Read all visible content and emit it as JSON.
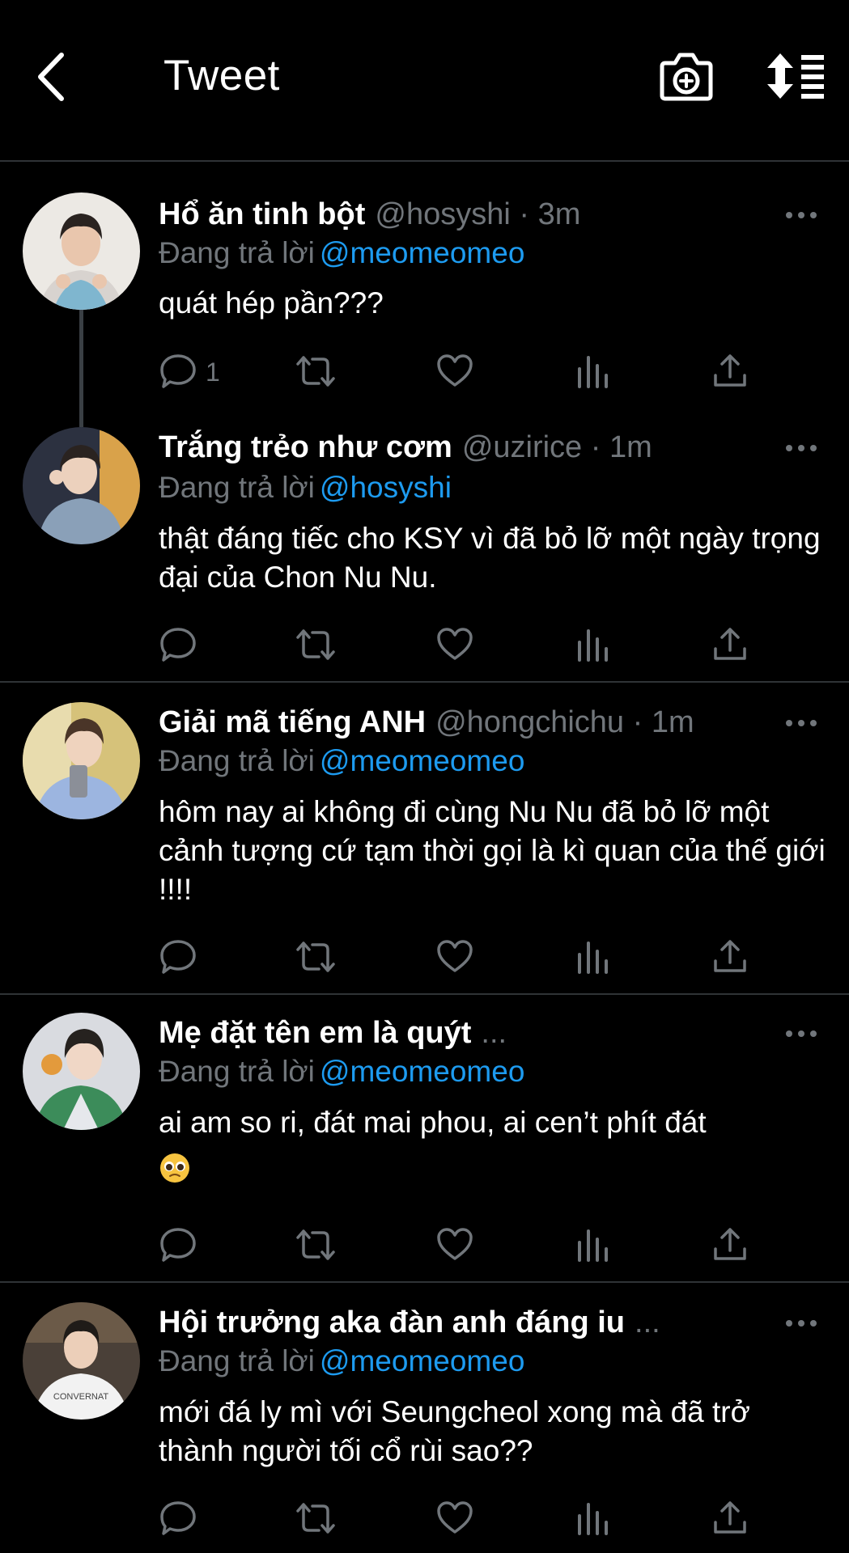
{
  "header": {
    "title": "Tweet",
    "back_icon": "chevron-left-icon",
    "camera_icon": "camera-add-icon",
    "sort_icon": "sort-list-icon"
  },
  "colors": {
    "background": "#000000",
    "text": "#ffffff",
    "muted": "#71767b",
    "link": "#1d9bf0",
    "divider": "#2f3336"
  },
  "reply_prefix": "Đang trả lời",
  "tweets": [
    {
      "name": "Hổ ăn tinh bột",
      "meta": "@hosyshi · 3m",
      "reply_to": "@meomeomeo",
      "text": "quát hép pần???",
      "reply_count": "1"
    },
    {
      "name": "Trắng trẻo như cơm",
      "meta": "@uzirice · 1m",
      "reply_to": "@hosyshi",
      "text": "thật đáng tiếc cho KSY vì đã bỏ lỡ một ngày trọng đại của Chon Nu Nu.",
      "reply_count": ""
    },
    {
      "name": "Giải mã tiếng ANH",
      "meta": "@hongchichu · 1m",
      "reply_to": "@meomeomeo",
      "text": "hôm nay ai không đi cùng Nu Nu đã bỏ lỡ một cảnh tượng cứ tạm thời gọi là kì quan của thế giới !!!!",
      "reply_count": ""
    },
    {
      "name": "Mẹ đặt tên em là quýt",
      "meta": "...",
      "reply_to": "@meomeomeo",
      "text": "ai am so ri, đát mai phou, ai cen’t phít đát",
      "emoji": "pleading-face-emoji",
      "reply_count": ""
    },
    {
      "name": "Hội trưởng aka đàn anh đáng iu",
      "meta": "...",
      "reply_to": "@meomeomeo",
      "text": "mới đá ly mì với Seungcheol xong mà đã trở thành người tối cổ rùi sao??",
      "reply_count": ""
    }
  ],
  "avatar_shirt_text": "CONVERNAT"
}
